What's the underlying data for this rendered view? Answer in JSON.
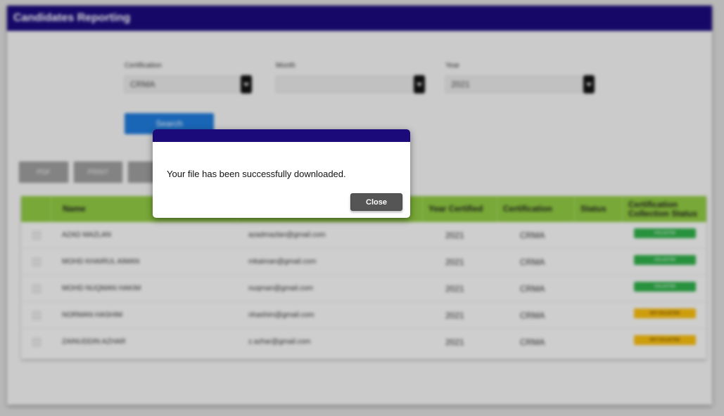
{
  "window": {
    "title": "Candidates Reporting"
  },
  "filters": {
    "certification": {
      "label": "Certification",
      "value": "CRMA"
    },
    "month": {
      "label": "Month",
      "value": ""
    },
    "year": {
      "label": "Year",
      "value": "2021"
    },
    "search_label": "Search"
  },
  "toolbar": {
    "pdf_label": "PDF",
    "print_label": "PRINT"
  },
  "table": {
    "headers": {
      "name": "Name",
      "year_certified": "Year Certified",
      "certification": "Certification",
      "status": "Status",
      "collection_status": "Certification Collection Status"
    },
    "rows": [
      {
        "name": "AZAD MAZLAN",
        "email": "azadmazlan@gmail.com",
        "year": "2021",
        "certification": "CRMA",
        "collection": "COLLECTED"
      },
      {
        "name": "MOHD KHAIRUL AIMAN",
        "email": "mkaiman@gmail.com",
        "year": "2021",
        "certification": "CRMA",
        "collection": "COLLECTED"
      },
      {
        "name": "MOHD NUQMAN HAKIM",
        "email": "nuqman@gmail.com",
        "year": "2021",
        "certification": "CRMA",
        "collection": "COLLECTED"
      },
      {
        "name": "NORMAN HASHIM",
        "email": "nhashim@gmail.com",
        "year": "2021",
        "certification": "CRMA",
        "collection": "NOT COLLECTED"
      },
      {
        "name": "ZAINUDDIN AZHAR",
        "email": "z.azhar@gmail.com",
        "year": "2021",
        "certification": "CRMA",
        "collection": "NOT COLLECTED"
      }
    ]
  },
  "dialog": {
    "message": "Your file has been successfully downloaded.",
    "close_label": "Close"
  },
  "colors": {
    "header_bg": "#1a0a7a",
    "table_header_bg": "#8dc641",
    "search_button": "#1e78d6",
    "collected_badge": "#2eab48",
    "not_collected_badge": "#f3b90f",
    "close_button": "#555555"
  }
}
